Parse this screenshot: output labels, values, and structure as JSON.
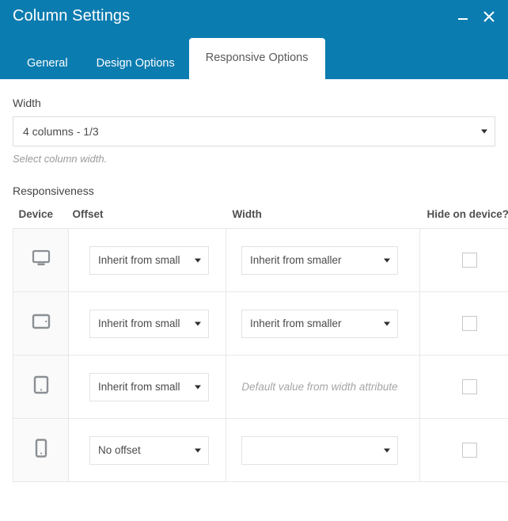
{
  "window": {
    "title": "Column Settings",
    "minimize_icon": "minimize-icon",
    "close_icon": "close-icon",
    "accent_color": "#0b7cb0"
  },
  "tabs": [
    {
      "label": "General",
      "active": false
    },
    {
      "label": "Design Options",
      "active": false
    },
    {
      "label": "Responsive Options",
      "active": true
    }
  ],
  "width_field": {
    "label": "Width",
    "value": "4 columns - 1/3",
    "helper": "Select column width."
  },
  "responsiveness": {
    "title": "Responsiveness",
    "columns": {
      "device": "Device",
      "offset": "Offset",
      "width": "Width",
      "hide": "Hide on device?"
    },
    "rows": [
      {
        "device_icon": "desktop-icon",
        "offset_value": "Inherit from small",
        "width_value": "Inherit from smaller",
        "width_is_placeholder": false,
        "hide_checked": false
      },
      {
        "device_icon": "tablet-landscape-icon",
        "offset_value": "Inherit from small",
        "width_value": "Inherit from smaller",
        "width_is_placeholder": false,
        "hide_checked": false
      },
      {
        "device_icon": "tablet-portrait-icon",
        "offset_value": "Inherit from small",
        "width_value": "Default value from width attribute",
        "width_is_placeholder": true,
        "hide_checked": false
      },
      {
        "device_icon": "mobile-icon",
        "offset_value": "No offset",
        "width_value": "",
        "width_is_placeholder": false,
        "hide_checked": false
      }
    ]
  }
}
